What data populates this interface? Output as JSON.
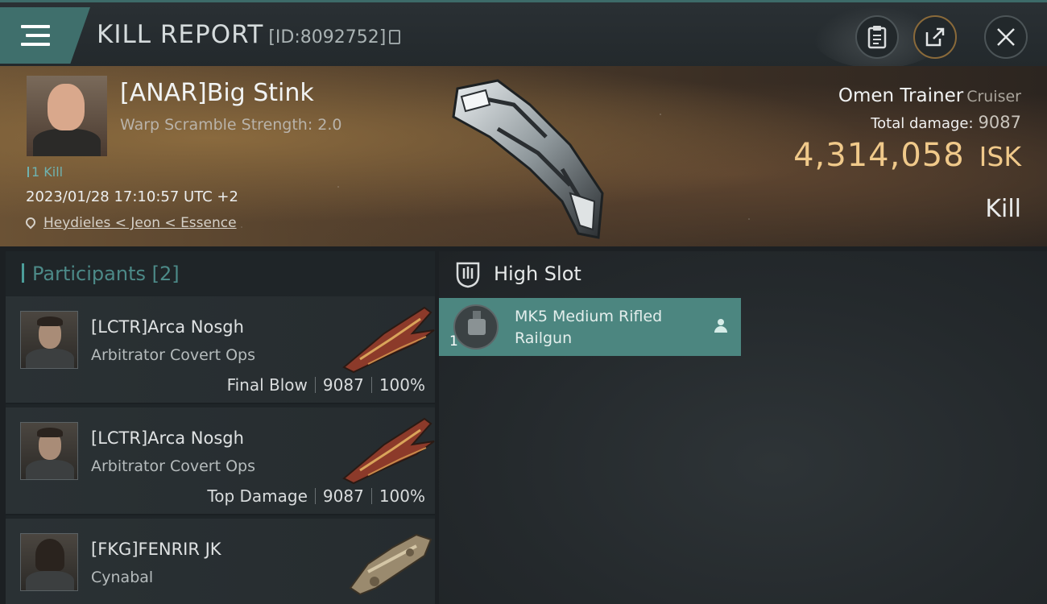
{
  "header": {
    "title": "KILL REPORT",
    "report_id": "[ID:8092752]",
    "icons": [
      "menu-icon",
      "copy-icon",
      "clipboard-icon",
      "share-icon",
      "close-icon"
    ]
  },
  "victim": {
    "name": "[ANAR]Big Stink",
    "warp_scramble": "Warp Scramble Strength: 2.0",
    "kill_count": "1 Kill",
    "datetime": "2023/01/28 17:10:57 UTC +2",
    "location": "Heydieles < Jeon < Essence",
    "ship_name": "Omen Trainer",
    "ship_class": "Cruiser",
    "total_damage_label": "Total damage:",
    "total_damage": "9087",
    "isk_value": "4,314,058",
    "isk_unit": "ISK",
    "result": "Kill"
  },
  "participants": {
    "header": "Participants [2]",
    "rows": [
      {
        "name": "[LCTR]Arca Nosgh",
        "ship": "Arbitrator Covert Ops",
        "tag": "Final Blow",
        "damage": "9087",
        "percent": "100%"
      },
      {
        "name": "[LCTR]Arca Nosgh",
        "ship": "Arbitrator Covert Ops",
        "tag": "Top Damage",
        "damage": "9087",
        "percent": "100%"
      },
      {
        "name": "[FKG]FENRIR JK",
        "ship": "Cynabal"
      }
    ]
  },
  "fittings": {
    "slot_label": "High Slot",
    "modules": [
      {
        "name": "MK5 Medium Rifled Railgun",
        "quantity": "1"
      }
    ]
  },
  "colors": {
    "accent": "#4c8680",
    "isk": "#f0c98a",
    "kill_count": "#6fb3b0"
  }
}
